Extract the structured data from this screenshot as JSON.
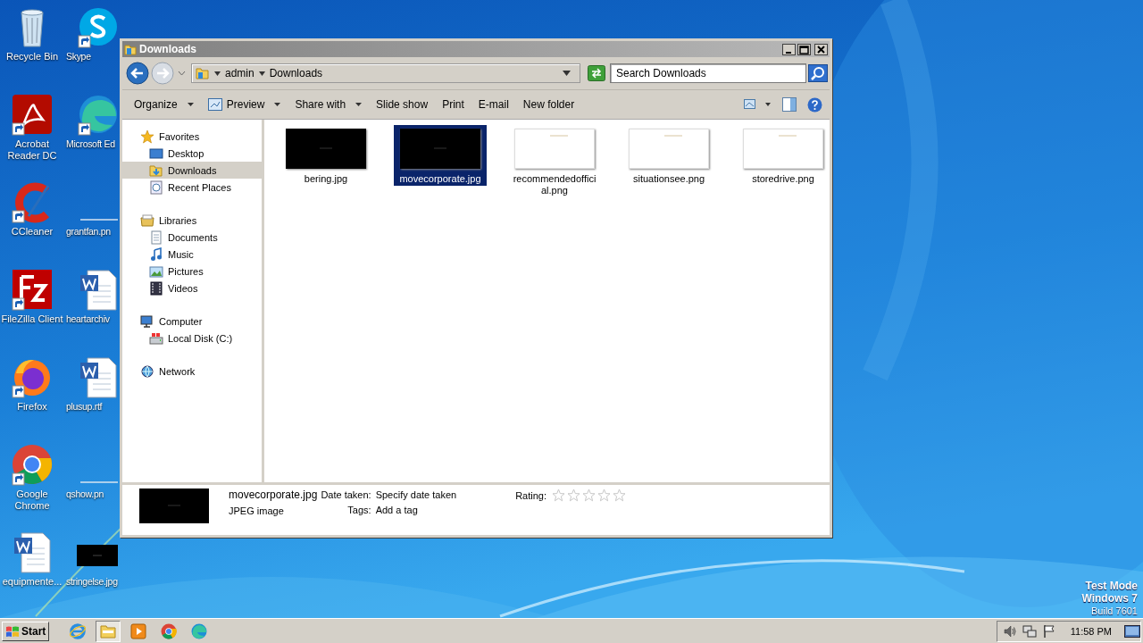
{
  "desktop": {
    "icons": [
      {
        "label": "Recycle Bin",
        "kind": "recycle",
        "shortcut": false
      },
      {
        "label": "Acrobat Reader DC",
        "kind": "acrobat",
        "shortcut": true
      },
      {
        "label": "CCleaner",
        "kind": "ccleaner",
        "shortcut": true
      },
      {
        "label": "FileZilla Client",
        "kind": "filezilla",
        "shortcut": true
      },
      {
        "label": "Firefox",
        "kind": "firefox",
        "shortcut": true
      },
      {
        "label": "Google Chrome",
        "kind": "chrome",
        "shortcut": true
      },
      {
        "label": "equipmente...",
        "kind": "word",
        "shortcut": false
      },
      {
        "label": "Skype",
        "kind": "skype",
        "shortcut": true
      },
      {
        "label": "Microsoft Ed",
        "kind": "edge",
        "shortcut": true
      },
      {
        "label": "grantfan.pn",
        "kind": "blank",
        "shortcut": false
      },
      {
        "label": "heartarchiv",
        "kind": "word",
        "shortcut": false
      },
      {
        "label": "plusup.rtf",
        "kind": "word",
        "shortcut": false
      },
      {
        "label": "qshow.pn",
        "kind": "blank",
        "shortcut": false
      },
      {
        "label": "stringelse.jpg",
        "kind": "dark",
        "shortcut": false
      }
    ],
    "os_notice": [
      "Test Mode",
      "Windows 7",
      "Build 7601"
    ]
  },
  "window": {
    "title": "Downloads",
    "address": {
      "crumbs": [
        "admin",
        "Downloads"
      ]
    },
    "search": {
      "placeholder": "Search Downloads"
    },
    "toolbar": [
      {
        "label": "Organize",
        "menu": true,
        "icon": false
      },
      {
        "label": "Preview",
        "menu": true,
        "icon": true
      },
      {
        "label": "Share with",
        "menu": true,
        "icon": false
      },
      {
        "label": "Slide show",
        "menu": false,
        "icon": false
      },
      {
        "label": "Print",
        "menu": false,
        "icon": false
      },
      {
        "label": "E-mail",
        "menu": false,
        "icon": false
      },
      {
        "label": "New folder",
        "menu": false,
        "icon": false
      }
    ],
    "navigation": [
      {
        "label": "Favorites",
        "kind": "star",
        "selected": false,
        "children": [
          {
            "label": "Desktop",
            "kind": "desktop",
            "selected": false
          },
          {
            "label": "Downloads",
            "kind": "downloads",
            "selected": true
          },
          {
            "label": "Recent Places",
            "kind": "recent",
            "selected": false
          }
        ]
      },
      {
        "label": "Libraries",
        "kind": "library",
        "selected": false,
        "children": [
          {
            "label": "Documents",
            "kind": "documents",
            "selected": false
          },
          {
            "label": "Music",
            "kind": "music",
            "selected": false
          },
          {
            "label": "Pictures",
            "kind": "pictures",
            "selected": false
          },
          {
            "label": "Videos",
            "kind": "videos",
            "selected": false
          }
        ]
      },
      {
        "label": "Computer",
        "kind": "computer",
        "selected": false,
        "children": [
          {
            "label": "Local Disk (C:)",
            "kind": "disk",
            "selected": false
          }
        ]
      },
      {
        "label": "Network",
        "kind": "network",
        "selected": false
      }
    ],
    "files": [
      {
        "name": "bering.jpg",
        "kind": "dark",
        "selected": false
      },
      {
        "name": "movecorporate.jpg",
        "kind": "dark",
        "selected": true
      },
      {
        "name": "recommendedofficial.png",
        "kind": "light",
        "selected": false
      },
      {
        "name": "situationsee.png",
        "kind": "light",
        "selected": false
      },
      {
        "name": "storedrive.png",
        "kind": "light",
        "selected": false
      }
    ],
    "details": {
      "name": "movecorporate.jpg",
      "type": "JPEG image",
      "date_label": "Date taken:",
      "date_value": "Specify date taken",
      "tags_label": "Tags:",
      "tags_value": "Add a tag",
      "rating_label": "Rating:",
      "stars": 0
    }
  },
  "taskbar": {
    "start": "Start",
    "apps": [
      {
        "kind": "ie",
        "active": false
      },
      {
        "kind": "explorer",
        "active": true
      },
      {
        "kind": "media",
        "active": false
      },
      {
        "kind": "chrome",
        "active": false
      },
      {
        "kind": "edge",
        "active": false
      }
    ],
    "clock": "11:58 PM"
  }
}
